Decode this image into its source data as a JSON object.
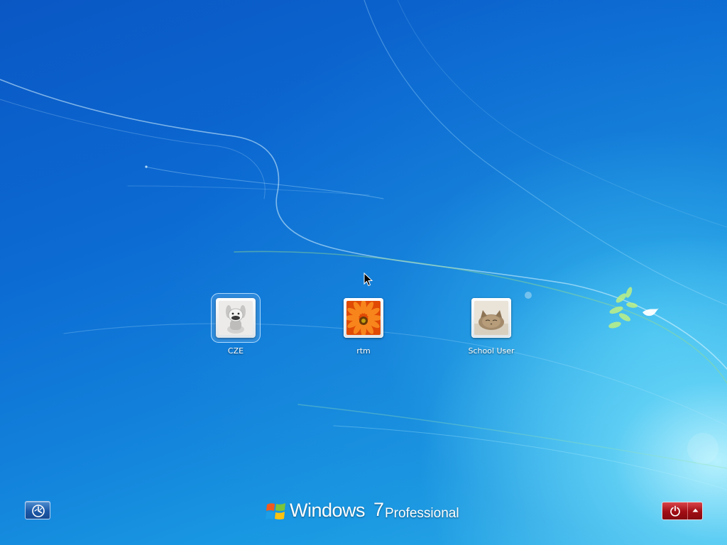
{
  "users": [
    {
      "name": "CZE",
      "picture": "robot-dog-picture",
      "focused": true
    },
    {
      "name": "rtm",
      "picture": "orange-flower-picture",
      "focused": false
    },
    {
      "name": "School User",
      "picture": "kitten-picture",
      "focused": false
    }
  ],
  "branding": {
    "product": "Windows",
    "version": "7",
    "edition": "Professional"
  },
  "footer": {
    "ease_of_access_icon": "ease-of-access-icon",
    "shutdown_icon": "power-icon",
    "shutdown_options_icon": "chevron-up-icon"
  },
  "colors": {
    "background_blue": "#0c6bd3",
    "shutdown_red": "#a10d14",
    "ease_blue": "#1b58a8"
  }
}
